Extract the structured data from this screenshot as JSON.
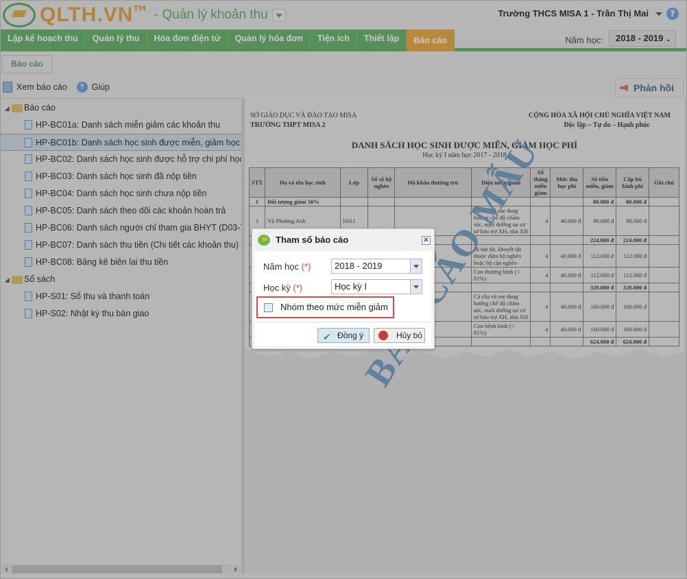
{
  "header": {
    "logo_text": "QLTH.VN",
    "logo_tm": "TM",
    "app_name": "- Quản lý khoản thu",
    "user": "Trường THCS MISA 1 - Trần Thị Mai"
  },
  "nav": {
    "tabs": [
      "Lập kế hoạch thu",
      "Quản lý thu",
      "Hóa đơn điện tử",
      "Quản lý hóa đơn",
      "Tiện ích",
      "Thiết lập",
      "Báo cáo"
    ],
    "active": "Báo cáo",
    "year_label": "Năm học:",
    "year_value": "2018 - 2019"
  },
  "subtab": "Báo cáo",
  "toolbar": {
    "view": "Xem báo cáo",
    "help": "Giúp",
    "feedback": "Phản hồi"
  },
  "tree": [
    {
      "label": "Báo cáo",
      "items": [
        "HP-BC01a: Danh sách miễn giảm các khoản thu",
        "HP-BC01b: Danh sách học sinh được miễn, giảm học phí",
        "HP-BC02: Danh sách học sinh được hỗ trợ chi phí học tập",
        "HP-BC03: Danh sách học sinh đã nộp tiền",
        "HP-BC04: Danh sách học sinh chưa nộp tiền",
        "HP-BC05: Danh sách theo dõi các khoản hoàn trả",
        "HP-BC06: Danh sách người chỉ tham gia BHYT (D03-TS)",
        "HP-BC07: Danh sách thu tiền (Chi tiết các khoản thu)",
        "HP-BC08: Bảng kê biên lai thu tiền"
      ]
    },
    {
      "label": "Sổ sách",
      "items": [
        "HP-S01: Sổ thu và thanh toán",
        "HP-S02: Nhật ký thu bàn giao"
      ]
    }
  ],
  "report": {
    "org1": "SỞ GIÁO DỤC VÀ ĐÀO TẠO MISA",
    "org2": "TRƯỜNG THPT MISA 2",
    "nation1": "CỘNG HÒA XÃ HỘI CHỦ NGHĨA VIỆT NAM",
    "nation2": "Độc lập – Tự do – Hạnh phúc",
    "title": "DANH SÁCH HỌC SINH ĐƯỢC MIỄN, GIẢM HỌC PHÍ",
    "subtitle": "Học kỳ I năm học 2017 - 2018",
    "columns": [
      "STT",
      "Họ và tên học sinh",
      "Lớp",
      "Số sổ hộ nghèo",
      "Hộ khẩu thường trú",
      "Diện miễn giảm",
      "Số tháng miễn giảm",
      "Mức thu học phí",
      "Số tiền miễn, giảm",
      "Cấp bù kinh phí",
      "Ghi chú"
    ],
    "rows": [
      [
        "I",
        "Đối tượng giảm 50%",
        "",
        "",
        "",
        "",
        "",
        "",
        "80.000 đ",
        "80.000 đ",
        ""
      ],
      [
        "1",
        "Vũ Phương Anh",
        "10A1",
        "",
        "",
        "Cả cha và mẹ đang hưởng chế độ chăm sóc, nuôi dưỡng tại cơ sở bảo trợ XH, nhà XH",
        "4",
        "40.000 đ",
        "80.000 đ",
        "80.000 đ",
        ""
      ],
      [
        "",
        "",
        "",
        "",
        "",
        "",
        "",
        "",
        "224.000 đ",
        "224.000 đ",
        ""
      ],
      [
        "",
        "",
        "",
        "",
        "",
        "Bị tàn tật, khuyết tật thuộc diện hộ nghèo hoặc hộ cận nghèo",
        "4",
        "40.000 đ",
        "112.000 đ",
        "112.000 đ",
        ""
      ],
      [
        "",
        "",
        "",
        "",
        "",
        "Con thương binh (< 81%)",
        "4",
        "40.000 đ",
        "112.000 đ",
        "112.000 đ",
        ""
      ],
      [
        "",
        "",
        "",
        "",
        "",
        "",
        "",
        "",
        "320.000 đ",
        "320.000 đ",
        ""
      ],
      [
        "",
        "",
        "",
        "",
        "",
        "Cả cha và mẹ đang hưởng chế độ chăm sóc, nuôi dưỡng tại cơ sở bảo trợ XH, nhà XH",
        "4",
        "40.000 đ",
        "160.000 đ",
        "160.000 đ",
        ""
      ],
      [
        "",
        "",
        "",
        "",
        "",
        "Con bệnh binh (< 81%)",
        "4",
        "40.000 đ",
        "160.000 đ",
        "160.000 đ",
        ""
      ],
      [
        "",
        "",
        "",
        "",
        "",
        "",
        "",
        "",
        "624.000 đ",
        "624.000 đ",
        ""
      ]
    ],
    "bold_rows": [
      0,
      2,
      5,
      8
    ],
    "watermark": "BÁO CÁO MẪU"
  },
  "dialog": {
    "title": "Tham số báo cáo",
    "year_label": "Năm học",
    "required": "(*)",
    "year_value": "2018 - 2019",
    "term_label": "Học kỳ",
    "term_value": "Học kỳ I",
    "group_label": "Nhóm theo mức miễn giảm",
    "group_checked": false,
    "ok": "Đồng ý",
    "cancel": "Hủy bỏ"
  }
}
